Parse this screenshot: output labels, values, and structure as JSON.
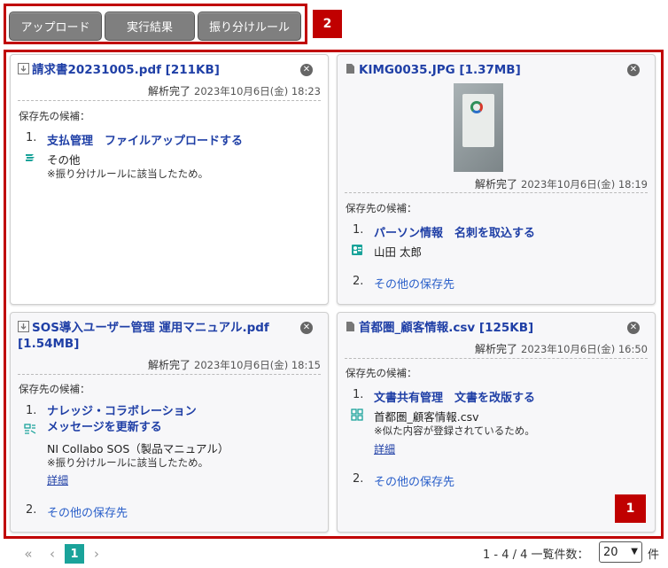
{
  "tabs": {
    "upload": "アップロード",
    "results": "実行結果",
    "rules": "振り分けルール"
  },
  "markers": {
    "tabs": "2",
    "main": "1"
  },
  "candidates_heading": "保存先の候補：",
  "status_label": "解析完了",
  "cards": [
    {
      "file": "請求書20231005.pdf [211KB]",
      "timestamp": "2023年10月6日(金) 18:23",
      "c1_num": "1.",
      "c1_link": "支払管理　ファイルアップロードする",
      "c1_value": "その他",
      "c1_note": "※振り分けルールに該当したため。"
    },
    {
      "file": "KIMG0035.JPG [1.37MB]",
      "timestamp": "2023年10月6日(金) 18:19",
      "c1_num": "1.",
      "c1_link": "パーソン情報　名刺を取込する",
      "c1_value": "山田 太郎",
      "c2_num": "2.",
      "c2_link": "その他の保存先"
    },
    {
      "file_line1": "SOS導入ユーザー管理 運用マニュアル.pdf",
      "file_line2": "[1.54MB]",
      "timestamp": "2023年10月6日(金) 18:15",
      "c1_num": "1.",
      "c1_link_line1": "ナレッジ・コラボレーション",
      "c1_link_line2": "メッセージを更新する",
      "c1_value": "NI Collabo SOS（製品マニュアル）",
      "c1_note": "※振り分けルールに該当したため。",
      "c1_detail": "詳細",
      "c2_num": "2.",
      "c2_link": "その他の保存先"
    },
    {
      "file": "首都圏_顧客情報.csv [125KB]",
      "timestamp": "2023年10月6日(金) 16:50",
      "c1_num": "1.",
      "c1_link": "文書共有管理　文書を改版する",
      "c1_value": "首都圏_顧客情報.csv",
      "c1_note": "※似た内容が登録されているため。",
      "c1_detail": "詳細",
      "c2_num": "2.",
      "c2_link": "その他の保存先"
    }
  ],
  "pagination": {
    "first": "«",
    "prev": "‹",
    "current": "1",
    "next": "›",
    "summary": "1 - 4 / 4 一覧件数：",
    "per_page": "20",
    "unit": "件"
  },
  "icons": {
    "download": "download-icon",
    "file": "file-icon",
    "close": "close-icon",
    "stack": "stack-icon",
    "person_card": "person-card-icon",
    "knowledge": "knowledge-icon",
    "document": "document-icon",
    "dropdown": "chevron-down-icon"
  },
  "colors": {
    "accent_red": "#c00000",
    "link": "#1f3fa6",
    "teal": "#1aa39a",
    "tab_gray": "#7f7f7f"
  }
}
